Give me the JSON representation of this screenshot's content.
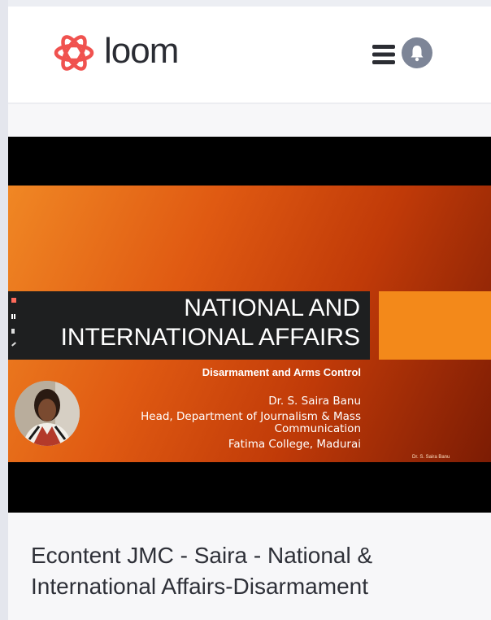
{
  "header": {
    "brand_name": "loom",
    "brand_color": "#f0524f",
    "icons": [
      "loom-logo-icon",
      "menu-icon",
      "notification-icon"
    ]
  },
  "video": {
    "slide": {
      "title_line1": "NATIONAL AND",
      "title_line2": "INTERNATIONAL AFFAIRS",
      "subtitle": "Disarmament and Arms Control",
      "author_name": "Dr. S. Saira Banu",
      "author_role_line1": "Head, Department of Journalism & Mass",
      "author_role_line2": "Communication",
      "author_institution": "Fatima College, Madurai",
      "corner_credit": "Dr. S. Saira Banu"
    },
    "colors": {
      "slide_orange": "#f08724",
      "slide_dark": "#7c1c04",
      "title_box": "#1e1f20"
    }
  },
  "video_title": {
    "line1": "Econtent JMC - Saira - National &",
    "line2": "International Affairs-Disarmament"
  }
}
